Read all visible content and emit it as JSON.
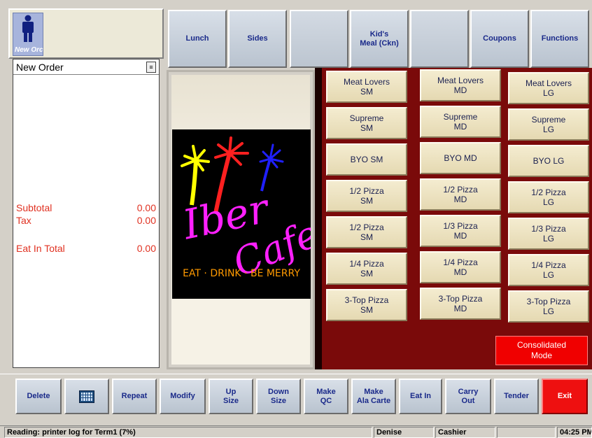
{
  "user_tile": {
    "label": "New Orc",
    "icon": "person-icon"
  },
  "top_buttons": [
    {
      "label": "Lunch"
    },
    {
      "label": "Sides"
    },
    {
      "label": ""
    },
    {
      "label": "Kid's\nMeal (Ckn)"
    },
    {
      "label": ""
    },
    {
      "label": "Coupons"
    },
    {
      "label": "Functions"
    }
  ],
  "order": {
    "title": "New Order",
    "subtotal_label": "Subtotal",
    "subtotal_value": "0.00",
    "tax_label": "Tax",
    "tax_value": "0.00",
    "total_label": "Eat In Total",
    "total_value": "0.00"
  },
  "logo": {
    "line1": "Iber",
    "line2": "Cafe",
    "tagline": "EAT · DRINK · BE MERRY",
    "colors": {
      "yellow": "#ffff00",
      "red": "#ff2020",
      "blue": "#2020ff",
      "magenta": "#ff20ff",
      "orange": "#ff9a00"
    }
  },
  "menu": {
    "col_sm": [
      "Meat Lovers\nSM",
      "Supreme\nSM",
      "BYO SM",
      "1/2 Pizza\nSM",
      "1/2 Pizza\nSM",
      "1/4 Pizza\nSM",
      "3-Top Pizza\nSM"
    ],
    "col_md": [
      "Meat Lovers\nMD",
      "Supreme\nMD",
      "BYO MD",
      "1/2 Pizza\nMD",
      "1/3 Pizza\nMD",
      "1/4 Pizza\nMD",
      "3-Top Pizza\nMD"
    ],
    "col_lg": [
      "Meat Lovers\nLG",
      "Supreme\nLG",
      "BYO LG",
      "1/2 Pizza\nLG",
      "1/3 Pizza\nLG",
      "1/4 Pizza\nLG",
      "3-Top Pizza\nLG"
    ],
    "consolidated": "Consolidated\nMode"
  },
  "bottom_buttons": {
    "delete": "Delete",
    "repeat": "Repeat",
    "modify": "Modify",
    "up_size": "Up\nSize",
    "down_size": "Down\nSize",
    "make_qc": "Make\nQC",
    "make_ala_carte": "Make\nAla Carte",
    "eat_in": "Eat In",
    "carry_out": "Carry\nOut",
    "tender": "Tender",
    "exit": "Exit"
  },
  "status": {
    "message": "Reading: printer log for Term1 (7%)",
    "user": "Denise",
    "role": "Cashier",
    "blank": "",
    "time": "04:25 PM"
  }
}
